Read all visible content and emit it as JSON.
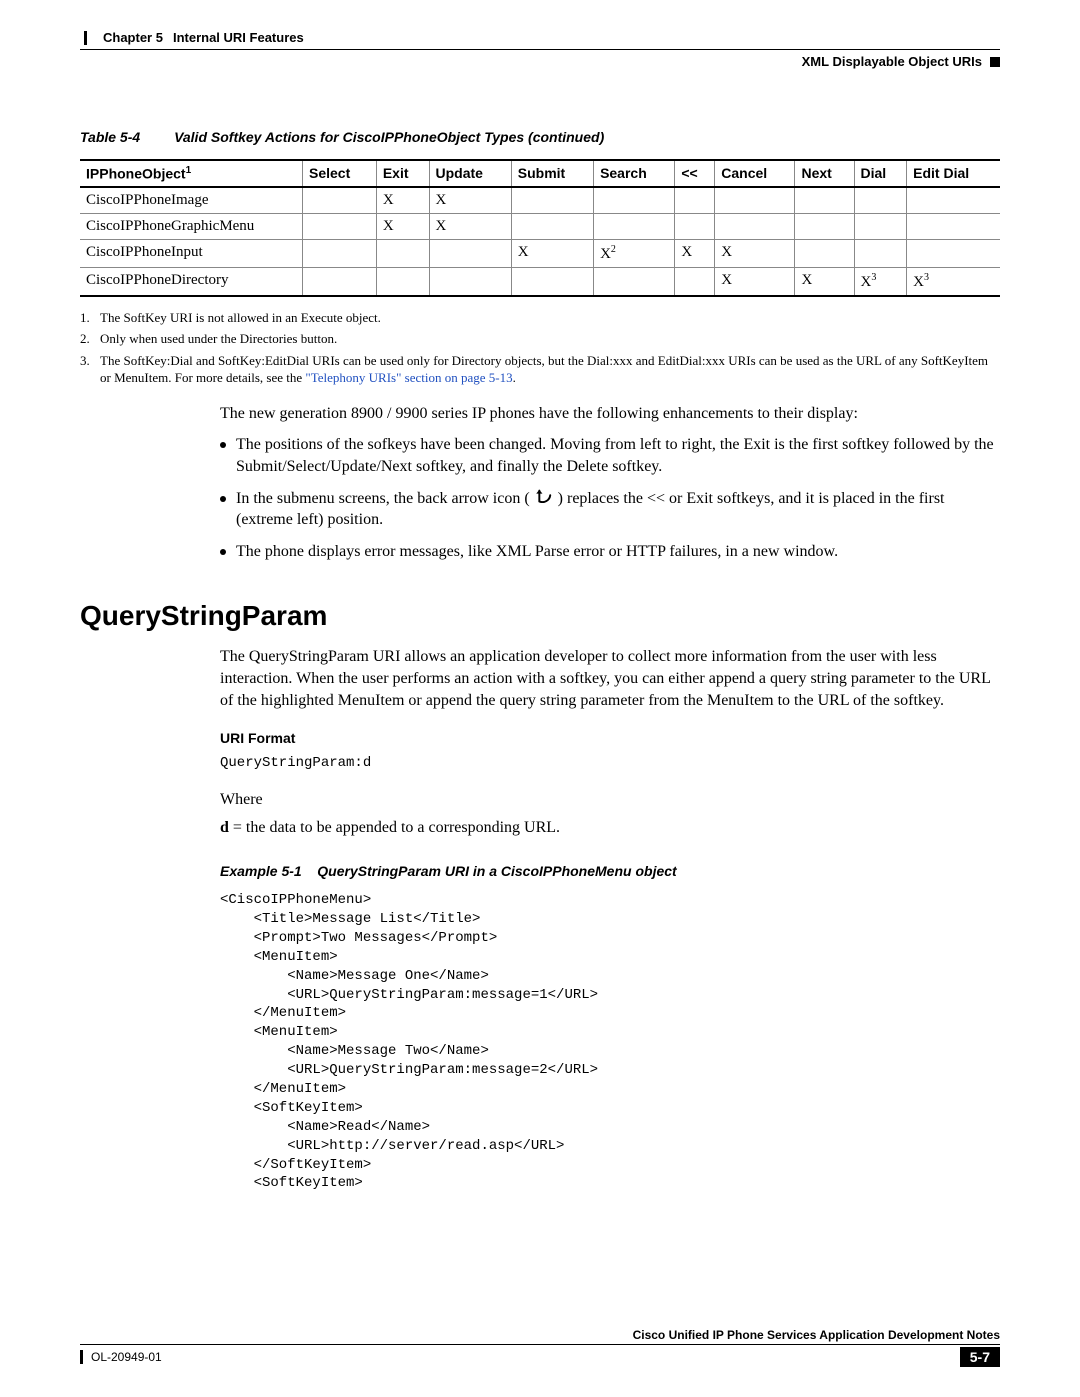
{
  "header": {
    "chapter": "Chapter 5",
    "chapter_title": "Internal URI Features",
    "right_label": "XML Displayable Object URIs"
  },
  "table": {
    "label": "Table 5-4",
    "caption": "Valid Softkey Actions for CiscoIPPhoneObject Types (continued)",
    "columns": [
      "IPPhoneObject",
      "Select",
      "Exit",
      "Update",
      "Submit",
      "Search",
      "<<",
      "Cancel",
      "Next",
      "Dial",
      "Edit Dial"
    ],
    "header_sup": "1",
    "rows": [
      {
        "name": "CiscoIPPhoneImage",
        "cells": [
          "",
          "X",
          "X",
          "",
          "",
          "",
          "",
          "",
          "",
          ""
        ]
      },
      {
        "name": "CiscoIPPhoneGraphicMenu",
        "cells": [
          "",
          "X",
          "X",
          "",
          "",
          "",
          "",
          "",
          "",
          ""
        ]
      },
      {
        "name": "CiscoIPPhoneInput",
        "cells": [
          "",
          "",
          "",
          "X",
          "X",
          "X",
          "X",
          "",
          "",
          ""
        ],
        "sup": {
          "4": "2"
        }
      },
      {
        "name": "CiscoIPPhoneDirectory",
        "cells": [
          "",
          "",
          "",
          "",
          "",
          "",
          "X",
          "X",
          "X",
          "X"
        ],
        "sup": {
          "8": "3",
          "9": "3"
        }
      }
    ]
  },
  "footnotes": [
    "The SoftKey URI is not allowed in an Execute object.",
    "Only when used under the Directories button.",
    "The SoftKey:Dial and SoftKey:EditDial URIs can be used only for Directory objects, but the Dial:xxx and EditDial:xxx URIs can be used as the URL of any SoftKeyItem or MenuItem. For more details, see the "
  ],
  "footnote3_link": "\"Telephony URIs\" section on page 5-13",
  "paragraph_intro": "The new generation 8900 / 9900 series IP phones have the following enhancements to their display:",
  "bullets": [
    "The positions of the sofkeys have been changed. Moving from left to right, the Exit is the first softkey followed by the Submit/Select/Update/Next softkey, and finally the Delete softkey.",
    [
      "In the submenu screens, the back arrow icon (",
      ") replaces the << or Exit softkeys, and it is placed in the first (extreme left) position."
    ],
    "The phone displays error messages, like XML Parse error or HTTP failures, in a new window."
  ],
  "section_title": "QueryStringParam",
  "section_para": "The QueryStringParam URI allows an application developer to collect more information from the user with less interaction. When the user performs an action with a softkey, you can either append a query string parameter to the URL of the highlighted MenuItem or append the query string parameter from the MenuItem to the URL of the softkey.",
  "uri_format_label": "URI Format",
  "uri_format_code": "QueryStringParam:d",
  "where_label": "Where",
  "where_line_prefix": "d",
  "where_line_rest": " = the data to be appended to a corresponding URL.",
  "example_label": "Example 5-1",
  "example_title": "QueryStringParam URI in a CiscoIPPhoneMenu object",
  "code_block": "<CiscoIPPhoneMenu>\n    <Title>Message List</Title>\n    <Prompt>Two Messages</Prompt>\n    <MenuItem>\n        <Name>Message One</Name>\n        <URL>QueryStringParam:message=1</URL>\n    </MenuItem>\n    <MenuItem>\n        <Name>Message Two</Name>\n        <URL>QueryStringParam:message=2</URL>\n    </MenuItem>\n    <SoftKeyItem>\n        <Name>Read</Name>\n        <URL>http://server/read.asp</URL>\n    </SoftKeyItem>\n    <SoftKeyItem>",
  "footer": {
    "doc_title": "Cisco Unified IP Phone Services Application Development Notes",
    "doc_id": "OL-20949-01",
    "page_num": "5-7"
  },
  "chart_data": {
    "type": "table",
    "title": "Valid Softkey Actions for CiscoIPPhoneObject Types (continued)",
    "columns": [
      "IPPhoneObject",
      "Select",
      "Exit",
      "Update",
      "Submit",
      "Search",
      "<<",
      "Cancel",
      "Next",
      "Dial",
      "Edit Dial"
    ],
    "rows": [
      [
        "CiscoIPPhoneImage",
        "",
        "X",
        "X",
        "",
        "",
        "",
        "",
        "",
        "",
        ""
      ],
      [
        "CiscoIPPhoneGraphicMenu",
        "",
        "X",
        "X",
        "",
        "",
        "",
        "",
        "",
        "",
        ""
      ],
      [
        "CiscoIPPhoneInput",
        "",
        "",
        "",
        "X",
        "X^2",
        "X",
        "X",
        "",
        "",
        ""
      ],
      [
        "CiscoIPPhoneDirectory",
        "",
        "",
        "",
        "",
        "",
        "",
        "X",
        "X",
        "X^3",
        "X^3"
      ]
    ]
  }
}
